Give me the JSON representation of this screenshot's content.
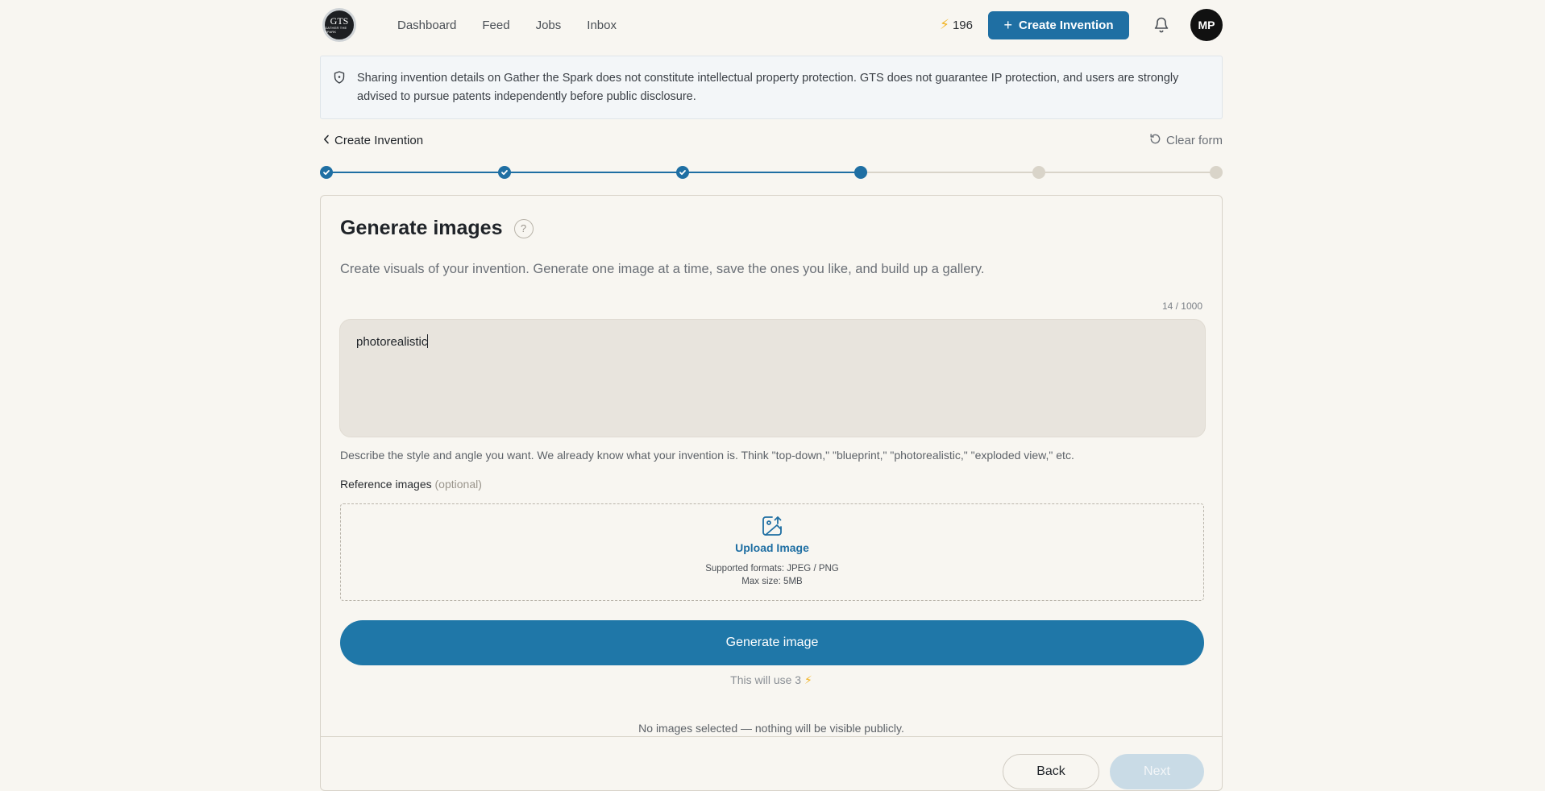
{
  "header": {
    "logo_text": "GTS",
    "logo_subtext": "GATHER THE SPARK",
    "nav": [
      "Dashboard",
      "Feed",
      "Jobs",
      "Inbox"
    ],
    "credits": "196",
    "create_button": "Create Invention",
    "avatar_initials": "MP"
  },
  "notice": {
    "text": "Sharing invention details on Gather the Spark does not constitute intellectual property protection. GTS does not guarantee IP protection, and users are strongly advised to pursue patents independently before public disclosure."
  },
  "subheader": {
    "back_label": "Create Invention",
    "clear_label": "Clear form"
  },
  "stepper": {
    "total": 6,
    "completed": 3,
    "current": 4
  },
  "card": {
    "title": "Generate images",
    "help_icon": "?",
    "subtitle": "Create visuals of your invention. Generate one image at a time, save the ones you like, and build up a gallery.",
    "counter": "14 / 1000",
    "prompt_value": "photorealistic",
    "hint": "Describe the style and angle you want. We already know what your invention is. Think \"top-down,\" \"blueprint,\" \"photorealistic,\" \"exploded view,\" etc.",
    "ref_label": "Reference images",
    "ref_optional": "(optional)",
    "upload_label": "Upload Image",
    "formats": "Supported formats: JPEG / PNG",
    "max_size": "Max size: 5MB",
    "generate_button": "Generate image",
    "uses_text": "This will use 3",
    "no_images_text": "No images selected — nothing will be visible publicly.",
    "back_button": "Back",
    "next_button": "Next"
  },
  "colors": {
    "primary": "#1f6fa3",
    "accent_bolt": "#f2b424",
    "background": "#f8f6f1"
  }
}
